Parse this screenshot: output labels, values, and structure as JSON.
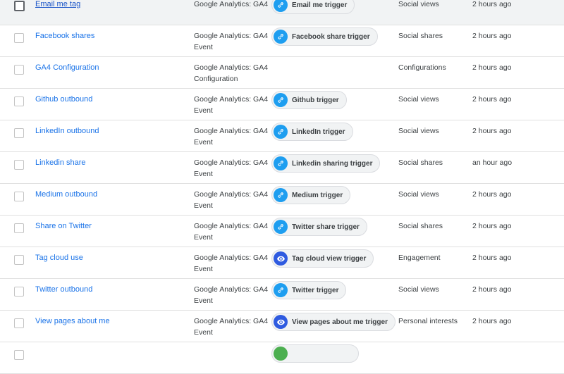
{
  "tags": [
    {
      "name": "Email me tag",
      "type_line1": "Google Analytics: GA4",
      "type_line2": "",
      "trigger": "Email me trigger",
      "trigger_icon": "link-icon",
      "folder": "Social views",
      "edited": "2 hours ago"
    },
    {
      "name": "Facebook shares",
      "type_line1": "Google Analytics: GA4",
      "type_line2": "Event",
      "trigger": "Facebook share trigger",
      "trigger_icon": "link-icon",
      "folder": "Social shares",
      "edited": "2 hours ago"
    },
    {
      "name": "GA4 Configuration",
      "type_line1": "Google Analytics: GA4",
      "type_line2": "Configuration",
      "trigger": "",
      "trigger_icon": "",
      "folder": "Configurations",
      "edited": "2 hours ago"
    },
    {
      "name": "Github outbound",
      "type_line1": "Google Analytics: GA4",
      "type_line2": "Event",
      "trigger": "Github trigger",
      "trigger_icon": "link-icon",
      "folder": "Social views",
      "edited": "2 hours ago"
    },
    {
      "name": "LinkedIn outbound",
      "type_line1": "Google Analytics: GA4",
      "type_line2": "Event",
      "trigger": "LinkedIn trigger",
      "trigger_icon": "link-icon",
      "folder": "Social views",
      "edited": "2 hours ago"
    },
    {
      "name": "Linkedin share",
      "type_line1": "Google Analytics: GA4",
      "type_line2": "Event",
      "trigger": "Linkedin sharing trigger",
      "trigger_icon": "link-icon",
      "folder": "Social shares",
      "edited": "an hour ago"
    },
    {
      "name": "Medium outbound",
      "type_line1": "Google Analytics: GA4",
      "type_line2": "Event",
      "trigger": "Medium trigger",
      "trigger_icon": "link-icon",
      "folder": "Social views",
      "edited": "2 hours ago"
    },
    {
      "name": "Share on Twitter",
      "type_line1": "Google Analytics: GA4",
      "type_line2": "Event",
      "trigger": "Twitter share trigger",
      "trigger_icon": "link-icon",
      "folder": "Social shares",
      "edited": "2 hours ago"
    },
    {
      "name": "Tag cloud use",
      "type_line1": "Google Analytics: GA4",
      "type_line2": "Event",
      "trigger": "Tag cloud view trigger",
      "trigger_icon": "eye-icon",
      "folder": "Engagement",
      "edited": "2 hours ago"
    },
    {
      "name": "Twitter outbound",
      "type_line1": "Google Analytics: GA4",
      "type_line2": "Event",
      "trigger": "Twitter trigger",
      "trigger_icon": "link-icon",
      "folder": "Social views",
      "edited": "2 hours ago"
    },
    {
      "name": "View pages about me",
      "type_line1": "Google Analytics: GA4",
      "type_line2": "Event",
      "trigger": "View pages about me trigger",
      "trigger_icon": "eye-icon",
      "folder": "Personal interests",
      "edited": "2 hours ago"
    },
    {
      "name": "",
      "type_line1": "",
      "type_line2": "",
      "trigger": "",
      "trigger_icon": "green-circle-icon",
      "folder": "",
      "edited": ""
    }
  ],
  "colors": {
    "link_blue": "#1a73e8",
    "link_icon_bg": "#1e9ef0",
    "eye_icon_bg": "#2f5be0",
    "partial_icon_bg": "#4caf50"
  }
}
